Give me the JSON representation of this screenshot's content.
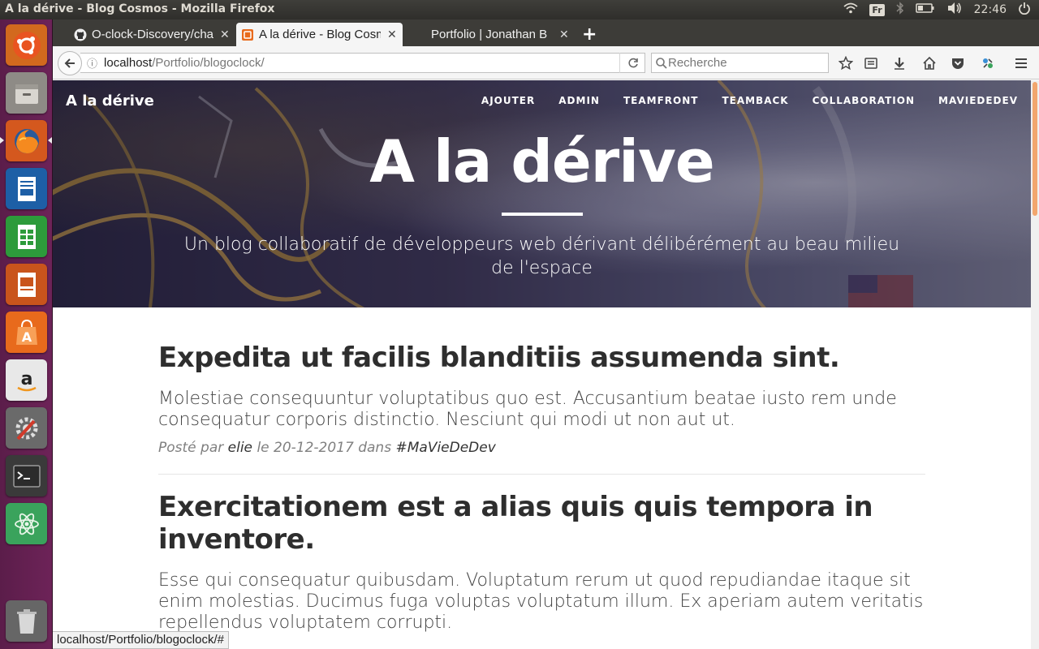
{
  "os": {
    "window_title": "A la dérive - Blog Cosmos - Mozilla Firefox",
    "keyboard_layout": "Fr",
    "clock": "22:46"
  },
  "launcher": {
    "items": [
      {
        "name": "ubuntu-dash-icon"
      },
      {
        "name": "files-icon"
      },
      {
        "name": "firefox-icon"
      },
      {
        "name": "writer-icon"
      },
      {
        "name": "calc-icon"
      },
      {
        "name": "impress-icon"
      },
      {
        "name": "software-center-icon"
      },
      {
        "name": "amazon-icon"
      },
      {
        "name": "system-settings-icon"
      },
      {
        "name": "terminal-icon"
      },
      {
        "name": "atom-icon"
      },
      {
        "name": "trash-icon"
      }
    ]
  },
  "browser": {
    "tabs": [
      {
        "label": "O-clock-Discovery/cha",
        "icon": "github-icon",
        "active": false
      },
      {
        "label": "A la dérive - Blog Cosm",
        "icon": "blog-favicon",
        "active": true
      },
      {
        "label": "Portfolio | Jonathan B",
        "icon": "",
        "active": false
      }
    ],
    "url_host": "localhost",
    "url_path": "/Portfolio/blogoclock/",
    "search_placeholder": "Recherche"
  },
  "site": {
    "brand": "A la dérive",
    "nav": [
      "AJOUTER",
      "ADMIN",
      "TEAMFRONT",
      "TEAMBACK",
      "COLLABORATION",
      "MAVIEDEDEV"
    ],
    "hero_title": "A la dérive",
    "hero_subtitle": "Un blog collaboratif de développeurs web dérivant délibérément au beau milieu de l'espace"
  },
  "posts": [
    {
      "title": "Expedita ut facilis blanditiis assumenda sint.",
      "excerpt": "Molestiae consequuntur voluptatibus quo est. Accusantium beatae iusto rem unde consequatur corporis distinctio. Nesciunt qui modi ut non aut ut.",
      "meta_prefix": "Posté par",
      "author": "elie",
      "meta_date": "le 20-12-2017 dans",
      "category": "#MaVieDeDev"
    },
    {
      "title": "Exercitationem est a alias quis quis tempora in inventore.",
      "excerpt": "Esse qui consequatur quibusdam. Voluptatum rerum ut quod repudiandae itaque sit enim molestias. Ducimus fuga voluptas voluptatum illum. Ex aperiam autem veritatis repellendus voluptatem corrupti."
    }
  ],
  "status_url": "localhost/Portfolio/blogoclock/#"
}
